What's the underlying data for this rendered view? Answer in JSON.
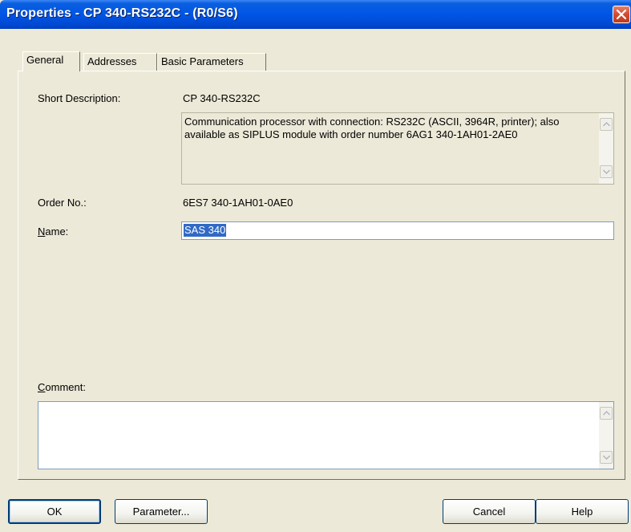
{
  "window": {
    "title": "Properties - CP 340-RS232C - (R0/S6)"
  },
  "tabs": [
    {
      "label": "General",
      "active": true
    },
    {
      "label": "Addresses",
      "active": false
    },
    {
      "label": "Basic Parameters",
      "active": false
    }
  ],
  "general": {
    "short_description_label": "Short Description:",
    "short_description_value": "CP 340-RS232C",
    "description_text": "Communication processor with connection: RS232C (ASCII, 3964R, printer); also available as SIPLUS module with order number 6AG1 340-1AH01-2AE0",
    "order_no_label": "Order No.:",
    "order_no_value": "6ES7 340-1AH01-0AE0",
    "name_label_access": "N",
    "name_label_rest": "ame:",
    "name_value": "SAS 340",
    "comment_label_access": "C",
    "comment_label_rest": "omment:",
    "comment_value": ""
  },
  "buttons": {
    "ok": "OK",
    "parameter": "Parameter...",
    "cancel": "Cancel",
    "help": "Help"
  },
  "icons": {
    "close": "close-icon",
    "scroll_up": "scroll-up-arrow-icon",
    "scroll_down": "scroll-down-arrow-icon"
  },
  "colors": {
    "titlebar": "#0055e5",
    "dialog_bg": "#ece9d8",
    "selection": "#316ac5",
    "close_button": "#d24b2f"
  }
}
